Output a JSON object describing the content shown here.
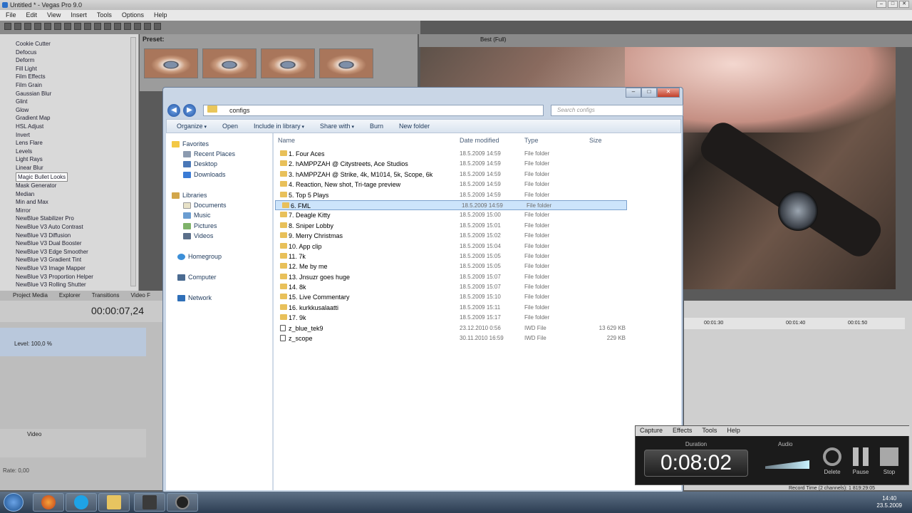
{
  "vegas": {
    "title": "Untitled * - Vegas Pro 9.0",
    "menu": [
      "File",
      "Edit",
      "View",
      "Insert",
      "Tools",
      "Options",
      "Help"
    ],
    "fx_list": [
      "Cookie Cutter",
      "Defocus",
      "Deform",
      "Fill Light",
      "Film Effects",
      "Film Grain",
      "Gaussian Blur",
      "Glint",
      "Glow",
      "Gradient Map",
      "HSL Adjust",
      "Invert",
      "Lens Flare",
      "Levels",
      "Light Rays",
      "Linear Blur",
      "Magic Bullet Looks",
      "Mask Generator",
      "Median",
      "Min and Max",
      "Mirror",
      "NewBlue Stabilizer Pro",
      "NewBlue V3 Auto Contrast",
      "NewBlue V3 Diffusion",
      "NewBlue V3 Dual Booster",
      "NewBlue V3 Edge Smoother",
      "NewBlue V3 Gradient Tint",
      "NewBlue V3 Image Mapper",
      "NewBlue V3 Proportion Helper",
      "NewBlue V3 Rolling Shutter"
    ],
    "preset_label": "Preset:",
    "tabs": [
      "Project Media",
      "Explorer",
      "Transitions",
      "Video F"
    ],
    "timecode": "00:00:07,24",
    "level": "Level: 100,0 %",
    "video_track": "Video",
    "rate": "Rate: 0,00",
    "preview_quality": "Best (Full)",
    "ruler": [
      "00:01:30",
      "00:01:40",
      "00:01:50"
    ]
  },
  "explorer": {
    "path": "configs",
    "search_placeholder": "Search configs",
    "commands": {
      "organize": "Organize",
      "open": "Open",
      "include": "Include in library",
      "share": "Share with",
      "burn": "Burn",
      "new_folder": "New folder"
    },
    "nav": {
      "favorites": "Favorites",
      "recent": "Recent Places",
      "desktop": "Desktop",
      "downloads": "Downloads",
      "libraries": "Libraries",
      "documents": "Documents",
      "music": "Music",
      "pictures": "Pictures",
      "videos": "Videos",
      "homegroup": "Homegroup",
      "computer": "Computer",
      "network": "Network"
    },
    "columns": {
      "name": "Name",
      "date": "Date modified",
      "type": "Type",
      "size": "Size"
    },
    "rows": [
      {
        "name": "1. Four Aces",
        "date": "18.5.2009 14:59",
        "type": "File folder",
        "size": ""
      },
      {
        "name": "2. hAMPPZAH @ Citystreets, Ace Studios",
        "date": "18.5.2009 14:59",
        "type": "File folder",
        "size": ""
      },
      {
        "name": "3. hAMPPZAH @ Strike, 4k, M1014, 5k, Scope, 6k",
        "date": "18.5.2009 14:59",
        "type": "File folder",
        "size": ""
      },
      {
        "name": "4. Reaction, New shot, Tri-tage preview",
        "date": "18.5.2009 14:59",
        "type": "File folder",
        "size": ""
      },
      {
        "name": "5. Top 5 Plays",
        "date": "18.5.2009 14:59",
        "type": "File folder",
        "size": ""
      },
      {
        "name": "6. FML",
        "date": "18.5.2009 14:59",
        "type": "File folder",
        "size": "",
        "selected": true
      },
      {
        "name": "7. Deagle Kitty",
        "date": "18.5.2009 15:00",
        "type": "File folder",
        "size": ""
      },
      {
        "name": "8. Sniper Lobby",
        "date": "18.5.2009 15:01",
        "type": "File folder",
        "size": ""
      },
      {
        "name": "9. Merry Christmas",
        "date": "18.5.2009 15:02",
        "type": "File folder",
        "size": ""
      },
      {
        "name": "10. App clip",
        "date": "18.5.2009 15:04",
        "type": "File folder",
        "size": ""
      },
      {
        "name": "11. 7k",
        "date": "18.5.2009 15:05",
        "type": "File folder",
        "size": ""
      },
      {
        "name": "12. Me by me",
        "date": "18.5.2009 15:05",
        "type": "File folder",
        "size": ""
      },
      {
        "name": "13. Jnsuzr goes huge",
        "date": "18.5.2009 15:07",
        "type": "File folder",
        "size": ""
      },
      {
        "name": "14. 8k",
        "date": "18.5.2009 15:07",
        "type": "File folder",
        "size": ""
      },
      {
        "name": "15. Live Commentary",
        "date": "18.5.2009 15:10",
        "type": "File folder",
        "size": ""
      },
      {
        "name": "16. kurkkusalaatti",
        "date": "18.5.2009 15:11",
        "type": "File folder",
        "size": ""
      },
      {
        "name": "17. 9k",
        "date": "18.5.2009 15:17",
        "type": "File folder",
        "size": ""
      },
      {
        "name": "z_blue_tek9",
        "date": "23.12.2010 0:56",
        "type": "IWD File",
        "size": "13 629 KB",
        "file": true
      },
      {
        "name": "z_scope",
        "date": "30.11.2010 16:59",
        "type": "IWD File",
        "size": "229 KB",
        "file": true
      }
    ]
  },
  "capture": {
    "menu": [
      "Capture",
      "Effects",
      "Tools",
      "Help"
    ],
    "duration_label": "Duration",
    "duration": "0:08:02",
    "audio_label": "Audio",
    "delete": "Delete",
    "pause": "Pause",
    "stop": "Stop",
    "record_time": "Record Time (2 channels): 1 819:29:05"
  },
  "taskbar": {
    "time": "14:40",
    "date": "23.5.2009"
  },
  "colors": {
    "selection": "#cce4fb",
    "folder": "#e8c05a",
    "accent": "#2c6fc7"
  }
}
